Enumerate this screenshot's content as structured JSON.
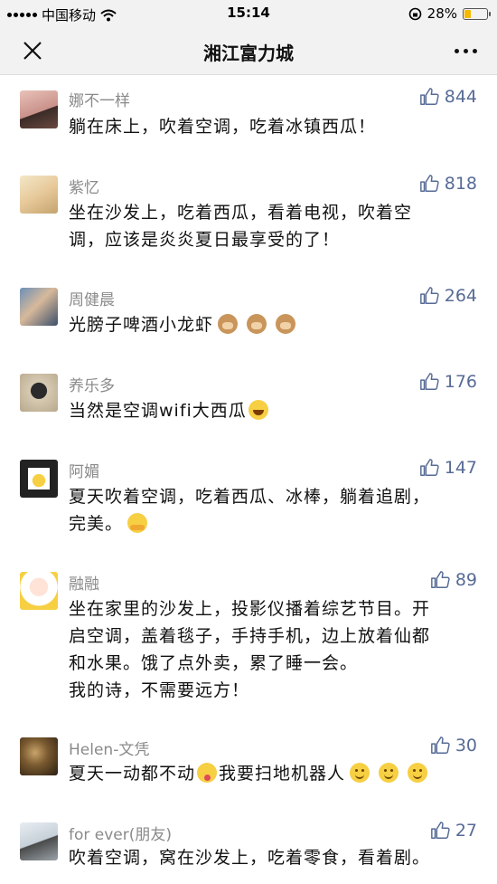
{
  "status_bar": {
    "carrier": "中国移动",
    "time": "15:14",
    "battery": "28%",
    "battery_level": 0.28
  },
  "nav": {
    "title": "湘江富力城"
  },
  "comments": [
    {
      "name": "娜不一样",
      "likes": "844",
      "text": [
        "躺在床上，吹着空调，吃着冰镇西瓜！"
      ],
      "avatar": "photo"
    },
    {
      "name": "紫忆",
      "likes": "818",
      "text": [
        "坐在沙发上，吃着西瓜，看着电视，吹着空",
        "调，应该是炎炎夏日最享受的了！"
      ],
      "avatar": "photo"
    },
    {
      "name": "周健晨",
      "likes": "264",
      "text": [
        "光膀子啤酒小龙虾"
      ],
      "emojis": [
        "see-no-evil-monkey",
        "see-no-evil-monkey",
        "see-no-evil-monkey"
      ],
      "avatar": "photo"
    },
    {
      "name": "养乐多",
      "likes": "176",
      "text": [
        "当然是空调wifi大西瓜"
      ],
      "emojis": [
        "laughing-face"
      ],
      "avatar": "photo"
    },
    {
      "name": "阿媚",
      "likes": "147",
      "text": [
        "夏天吹着空调，吃着西瓜、冰棒，躺着追剧，",
        "完美。"
      ],
      "emojis": [
        "hugging-face"
      ],
      "avatar": "drawing"
    },
    {
      "name": "融融",
      "likes": "89",
      "text": [
        "坐在家里的沙发上，投影仪播着综艺节目。开",
        "启空调，盖着毯子，手持手机，边上放着仙都",
        "和水果。饿了点外卖，累了睡一会。",
        "我的诗，不需要远方！"
      ],
      "avatar": "cartoon"
    },
    {
      "name": "Helen-文凭",
      "likes": "30",
      "text": [
        "夏天一动都不动",
        "我要扫地机器人"
      ],
      "emojis": [
        "tongue-face",
        "smile-face",
        "smile-face",
        "smile-face"
      ],
      "avatar": "photo"
    },
    {
      "name": "for ever(朋友)",
      "likes": "27",
      "text": [
        "吹着空调，窝在沙发上，吃着零食，看着剧。"
      ],
      "avatar": "photo"
    }
  ],
  "colors": {
    "like_blue": "#576b95",
    "name_gray": "#8a8a8a",
    "battery_yellow": "#f5b800"
  }
}
